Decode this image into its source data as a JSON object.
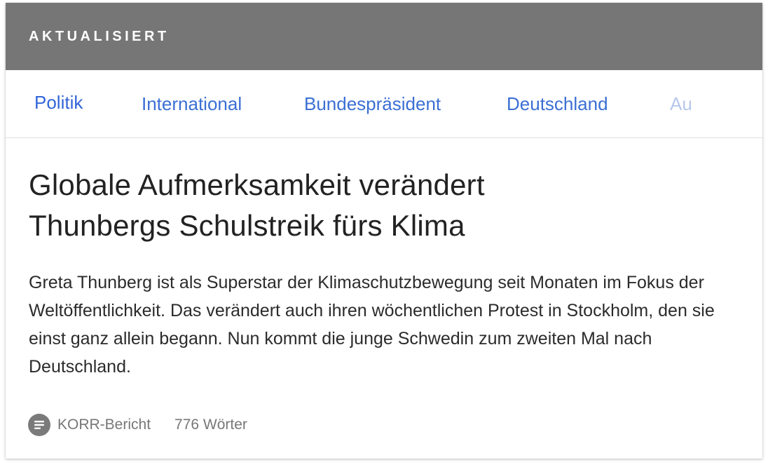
{
  "header": {
    "label": "AKTUALISIERT"
  },
  "tabs": [
    {
      "label": "Politik",
      "active": true
    },
    {
      "label": "International"
    },
    {
      "label": "Bundespräsident"
    },
    {
      "label": "Deutschland"
    },
    {
      "label": "Au"
    }
  ],
  "article": {
    "title_line1": "Globale Aufmerksamkeit verändert",
    "title_line2": "Thunbergs Schulstreik fürs Klima",
    "summary": "Greta Thunberg ist als Superstar der Klimaschutzbewegung seit Monaten im Fokus der Weltöffentlichkeit. Das verändert auch ihren wöchentlichen Protest in Stockholm, den sie einst ganz allein begann. Nun kommt die junge Schwedin zum zweiten Mal nach Deutschland."
  },
  "meta": {
    "icon": "document-icon",
    "type_label": "KORR-Bericht",
    "word_count": "776 Wörter"
  },
  "colors": {
    "header_bg": "#767676",
    "tab_link": "#3b6fd4"
  }
}
